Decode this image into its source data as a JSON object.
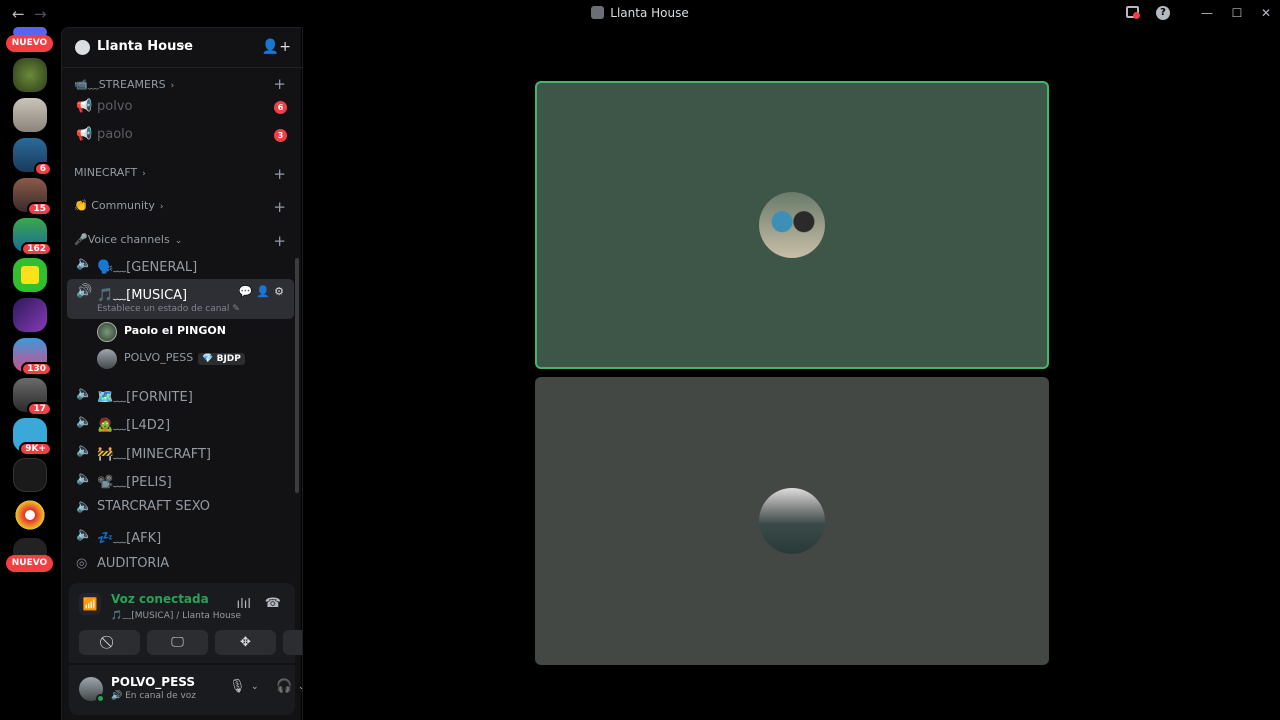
{
  "window": {
    "title": "Llanta House",
    "back": "←",
    "forward": "→",
    "inbox_icon": "inbox-icon",
    "help": "?",
    "min": "—",
    "max": "☐",
    "close": "✕"
  },
  "guild_bar": {
    "new_top": "NUEVO",
    "new_bottom": "NUEVO",
    "guilds": [
      {
        "name": "guild-1",
        "badge": ""
      },
      {
        "name": "guild-2",
        "badge": ""
      },
      {
        "name": "guild-3",
        "badge": "6"
      },
      {
        "name": "guild-4",
        "badge": "15"
      },
      {
        "name": "guild-5",
        "badge": "162"
      },
      {
        "name": "guild-6",
        "badge": ""
      },
      {
        "name": "guild-7",
        "badge": ""
      },
      {
        "name": "guild-8",
        "badge": "130"
      },
      {
        "name": "guild-9",
        "badge": "17"
      },
      {
        "name": "guild-10",
        "badge": "9K+"
      },
      {
        "name": "guild-11",
        "badge": ""
      },
      {
        "name": "guild-12",
        "badge": ""
      }
    ]
  },
  "server": {
    "name": "Llanta House",
    "chevron": "⌄"
  },
  "categories": {
    "streamers": "📹﹏STREAMERS",
    "minecraft": "MINECRAFT",
    "community": "👏 Community",
    "voice": "🎤Voice channels"
  },
  "channels": {
    "polvo": {
      "label": "polvo",
      "mentions": "6"
    },
    "paolo": {
      "label": "paolo",
      "mentions": "3"
    },
    "general": "🗣️﹏[GENERAL]",
    "musica": {
      "label": "🎵﹏[MUSICA]",
      "status": "Establece un estado de canal ✎"
    },
    "fornite": "🗺️﹏[FORNITE]",
    "l4d2": "🧟﹏[L4D2]",
    "minecraft": "🚧﹏[MINECRAFT]",
    "pelis": "📽️﹏[PELIS]",
    "starcraft": "STARCRAFT SEXO",
    "afk": "💤﹏[AFK]",
    "auditoria": "AUDITORIA"
  },
  "voice_users": [
    {
      "name": "Paolo el PINGON",
      "tag": ""
    },
    {
      "name": "POLVO_PESS",
      "tag": "💎 BJDP"
    }
  ],
  "voice_panel": {
    "status": "Voz conectada",
    "channel": "🎵﹏[MUSICA] / Llanta House"
  },
  "user_panel": {
    "username": "POLVO_PESS",
    "status": "🔊 En canal de voz"
  },
  "colors": {
    "connected": "#23a559",
    "speaking_border": "#3fb86b",
    "badge": "#f23f43"
  }
}
